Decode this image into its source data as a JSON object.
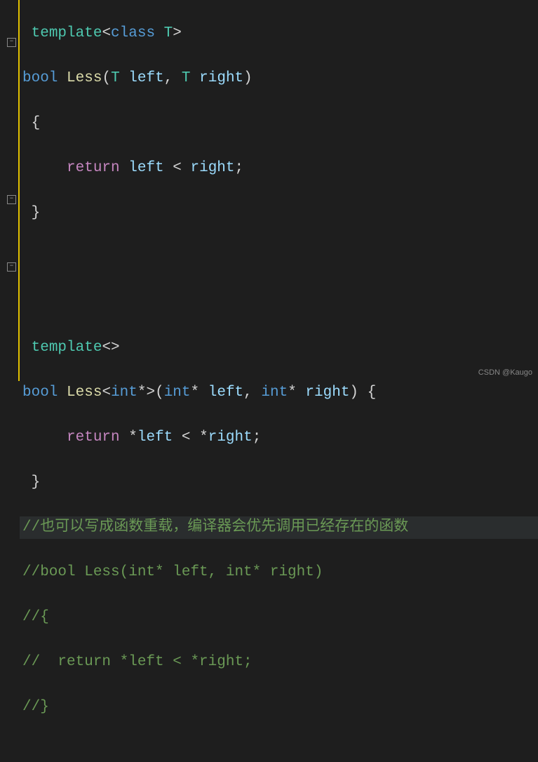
{
  "watermark": "CSDN @Kaugo",
  "code": {
    "l1": {
      "template": "template",
      "class": "class",
      "T": "T"
    },
    "l2": {
      "bool": "bool",
      "fn": "Less",
      "T1": "T",
      "left": "left",
      "T2": "T",
      "right": "right"
    },
    "l3": {
      "brace": "{"
    },
    "l4": {
      "ret": "return",
      "left": "left",
      "op": "<",
      "right": "right"
    },
    "l5": {
      "brace": "}"
    },
    "l6": {
      "template": "template"
    },
    "l7": {
      "bool": "bool",
      "fn": "Less",
      "int1": "int",
      "int2": "int",
      "left": "left",
      "int3": "int",
      "right": "right"
    },
    "l8": {
      "ret": "return",
      "left": "left",
      "op": "<",
      "right": "right"
    },
    "l9": {
      "brace": "}"
    },
    "c1": "//也可以写成函数重载，编译器会优先调用已经存在的函数",
    "c2": "//bool Less(int* left, int* right)",
    "c3": "//{",
    "c4": "//  return *left < *right;",
    "c5": "//}"
  }
}
